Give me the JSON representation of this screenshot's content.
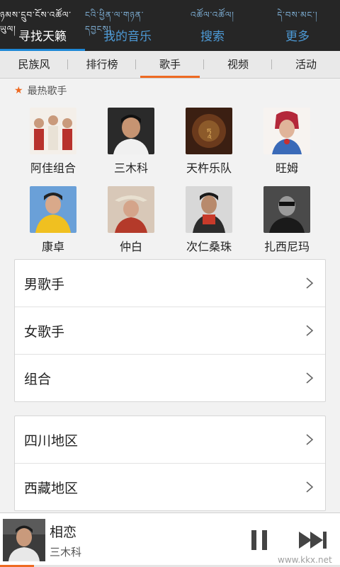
{
  "top_nav": [
    {
      "tibetan": "ཉམས་དྲུབ་ངོས་འཚོལ་ཡུལ།",
      "label": "寻找天籁",
      "active": true
    },
    {
      "tibetan": "ངའི་ཕྱིན་ལ་གཉན་དབྱངས།",
      "label": "我的音乐",
      "active": false
    },
    {
      "tibetan": "འཚོལ་འཚོལ།",
      "label": "搜索",
      "active": false
    },
    {
      "tibetan": "དེ་བས་མང་།",
      "label": "更多",
      "active": false
    }
  ],
  "sub_tabs": [
    {
      "label": "民族风",
      "active": false
    },
    {
      "label": "排行榜",
      "active": false
    },
    {
      "label": "歌手",
      "active": true
    },
    {
      "label": "视频",
      "active": false
    },
    {
      "label": "活动",
      "active": false
    }
  ],
  "hot_singers": {
    "title": "最热歌手",
    "star_icon": "star-icon",
    "singers": [
      {
        "name": "阿佳组合"
      },
      {
        "name": "三木科"
      },
      {
        "name": "天杵乐队"
      },
      {
        "name": "旺姆"
      },
      {
        "name": "康卓"
      },
      {
        "name": "仲白"
      },
      {
        "name": "次仁桑珠"
      },
      {
        "name": "扎西尼玛"
      }
    ]
  },
  "categories": [
    {
      "label": "男歌手"
    },
    {
      "label": "女歌手"
    },
    {
      "label": "组合"
    }
  ],
  "regions": [
    {
      "label": "四川地区"
    },
    {
      "label": "西藏地区"
    }
  ],
  "player": {
    "song": "相恋",
    "artist": "三木科",
    "progress": 0.1
  },
  "watermark": "www.kkx.net",
  "colors": {
    "accent": "#ee6a22",
    "nav_bg": "#262626",
    "nav_active": "#1e88d6"
  }
}
